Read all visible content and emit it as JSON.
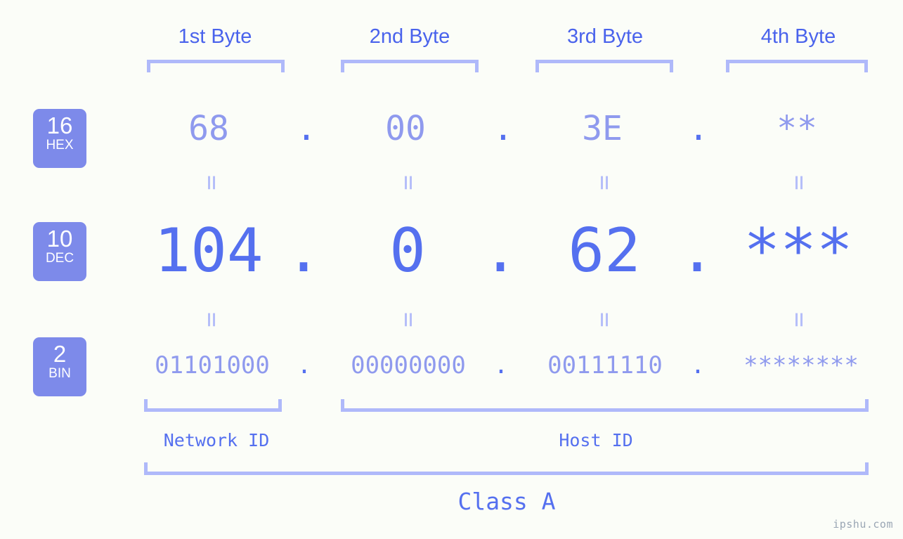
{
  "watermark": "ipshu.com",
  "byte_headers": [
    {
      "label": "1st Byte"
    },
    {
      "label": "2nd Byte"
    },
    {
      "label": "3rd Byte"
    },
    {
      "label": "4th Byte"
    }
  ],
  "bases": [
    {
      "num": "16",
      "abbr": "HEX"
    },
    {
      "num": "10",
      "abbr": "DEC"
    },
    {
      "num": "2",
      "abbr": "BIN"
    }
  ],
  "separator": ".",
  "equals_glyph": "=",
  "rows": {
    "hex": {
      "base_num": "16",
      "base_abbr": "HEX",
      "values": [
        "68",
        "00",
        "3E",
        "**"
      ]
    },
    "dec": {
      "base_num": "10",
      "base_abbr": "DEC",
      "values": [
        "104",
        "0",
        "62",
        "***"
      ]
    },
    "bin": {
      "base_num": "2",
      "base_abbr": "BIN",
      "values": [
        "01101000",
        "00000000",
        "00111110",
        "********"
      ]
    }
  },
  "sections": {
    "network_id": "Network ID",
    "host_id": "Host ID",
    "class": "Class A"
  },
  "colors": {
    "background": "#fbfdf8",
    "accent_strong": "#4a63ec",
    "accent_mid": "#5570ef",
    "accent_light": "#8f9aee",
    "bracket": "#afb9fa",
    "badge_fill": "#7d8aea",
    "badge_text": "#ffffff",
    "watermark_text": "#9aa6b4"
  }
}
